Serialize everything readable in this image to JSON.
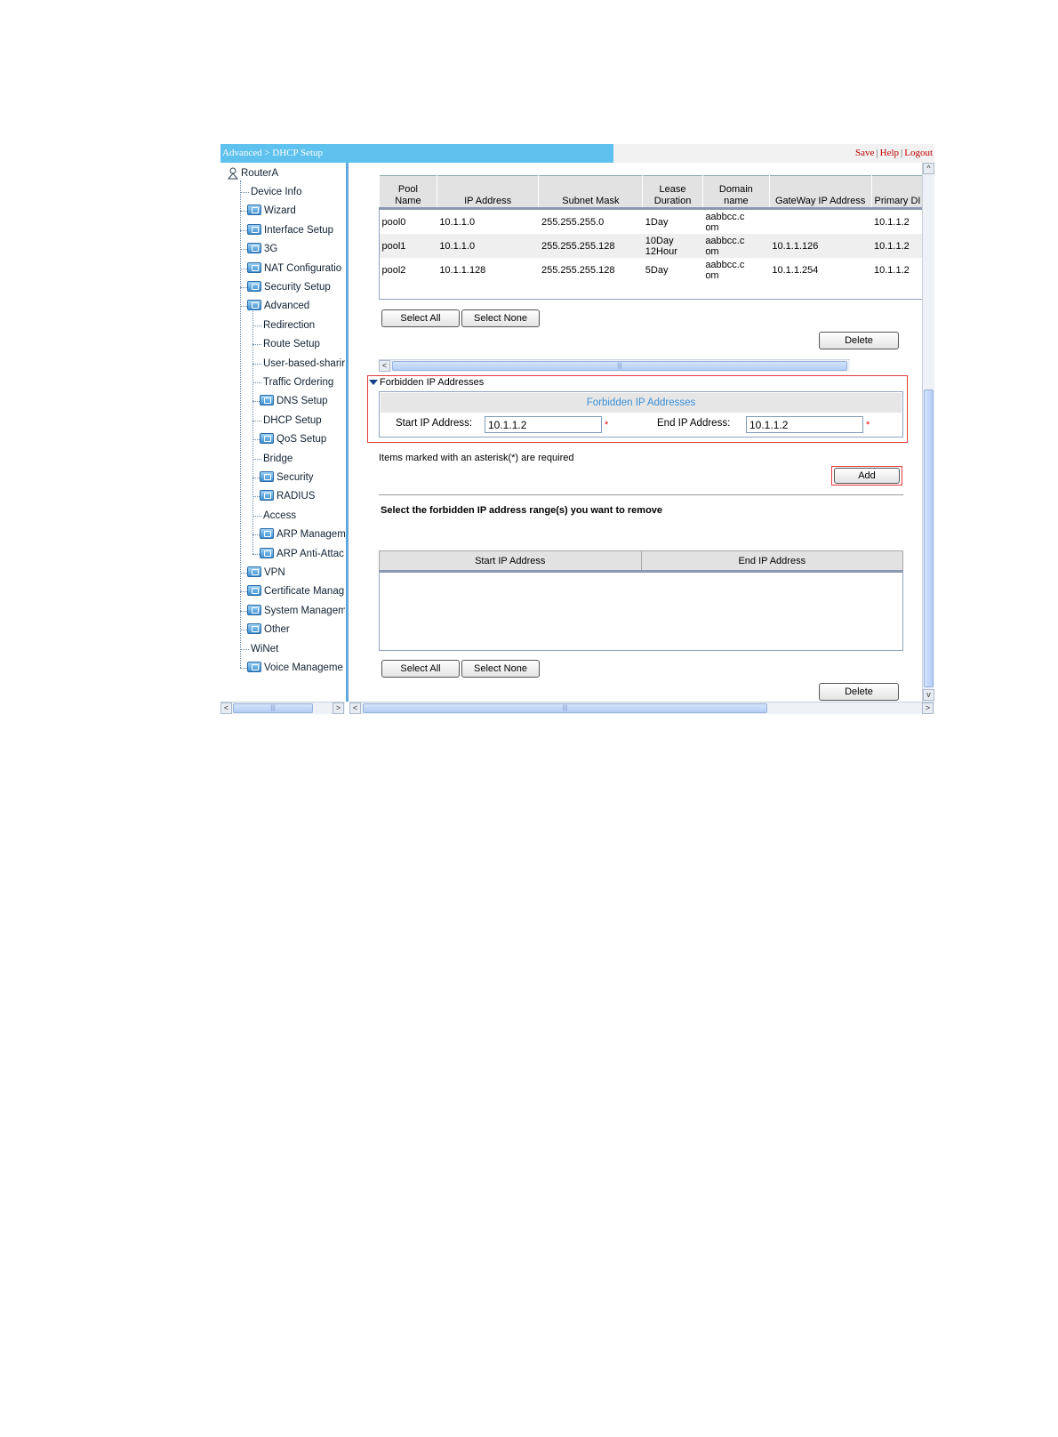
{
  "header": {
    "breadcrumb": "Advanced > DHCP Setup",
    "save": "Save",
    "help": "Help",
    "logout": "Logout",
    "separator": "|"
  },
  "sidebar": {
    "root": "RouterA",
    "items": [
      {
        "label": "Device Info",
        "icon": "none",
        "level": 1
      },
      {
        "label": "Wizard",
        "icon": "folder-icon",
        "level": 1
      },
      {
        "label": "Interface Setup",
        "icon": "folder-icon",
        "level": 1
      },
      {
        "label": "3G",
        "icon": "folder-icon",
        "level": 1
      },
      {
        "label": "NAT Configuratio",
        "icon": "folder-icon",
        "level": 1
      },
      {
        "label": "Security Setup",
        "icon": "folder-icon",
        "level": 1
      },
      {
        "label": "Advanced",
        "icon": "folder-icon",
        "level": 1
      },
      {
        "label": "Redirection",
        "icon": "none",
        "level": 2
      },
      {
        "label": "Route Setup",
        "icon": "none",
        "level": 2
      },
      {
        "label": "User-based-sharir",
        "icon": "none",
        "level": 2
      },
      {
        "label": "Traffic Ordering",
        "icon": "none",
        "level": 2
      },
      {
        "label": "DNS Setup",
        "icon": "folder-icon",
        "level": 2
      },
      {
        "label": "DHCP Setup",
        "icon": "none",
        "level": 2
      },
      {
        "label": "QoS Setup",
        "icon": "folder-icon",
        "level": 2
      },
      {
        "label": "Bridge",
        "icon": "none",
        "level": 2
      },
      {
        "label": "Security",
        "icon": "folder-icon",
        "level": 2
      },
      {
        "label": "RADIUS",
        "icon": "folder-icon",
        "level": 2
      },
      {
        "label": "Access",
        "icon": "none",
        "level": 2
      },
      {
        "label": "ARP Managem",
        "icon": "folder-icon",
        "level": 2
      },
      {
        "label": "ARP Anti-Attac",
        "icon": "folder-icon",
        "level": 2
      },
      {
        "label": "VPN",
        "icon": "folder-icon",
        "level": 1
      },
      {
        "label": "Certificate Manag",
        "icon": "folder-icon",
        "level": 1
      },
      {
        "label": "System Managem",
        "icon": "folder-icon",
        "level": 1
      },
      {
        "label": "Other",
        "icon": "folder-icon",
        "level": 1
      },
      {
        "label": "WiNet",
        "icon": "none",
        "level": 1
      },
      {
        "label": "Voice Manageme",
        "icon": "folder-icon",
        "level": 1
      }
    ]
  },
  "pool_table": {
    "columns": [
      {
        "l1": "Pool",
        "l2": "Name"
      },
      {
        "l1": "",
        "l2": "IP Address"
      },
      {
        "l1": "",
        "l2": "Subnet Mask"
      },
      {
        "l1": "Lease",
        "l2": "Duration"
      },
      {
        "l1": "Domain",
        "l2": "name"
      },
      {
        "l1": "",
        "l2": "GateWay IP Address"
      },
      {
        "l1": "",
        "l2": "Primary DI"
      }
    ],
    "rows": [
      {
        "name": "pool0",
        "ip": "10.1.1.0",
        "mask": "255.255.255.0",
        "lease1": "1Day",
        "lease2": "",
        "domain1": "aabbcc.c",
        "domain2": "om",
        "gateway": "",
        "dns": "10.1.1.2"
      },
      {
        "name": "pool1",
        "ip": "10.1.1.0",
        "mask": "255.255.255.128",
        "lease1": "10Day",
        "lease2": "12Hour",
        "domain1": "aabbcc.c",
        "domain2": "om",
        "gateway": "10.1.1.126",
        "dns": "10.1.1.2"
      },
      {
        "name": "pool2",
        "ip": "10.1.1.128",
        "mask": "255.255.255.128",
        "lease1": "5Day",
        "lease2": "",
        "domain1": "aabbcc.c",
        "domain2": "om",
        "gateway": "10.1.1.254",
        "dns": "10.1.1.2"
      }
    ],
    "select_all": "Select All",
    "select_none": "Select None",
    "delete": "Delete"
  },
  "forbidden": {
    "section_title": "Forbidden IP Addresses",
    "box_title": "Forbidden IP Addresses",
    "start_label": "Start IP Address:",
    "start_value": "10.1.1.2",
    "end_label": "End IP Address:",
    "end_value": "10.1.1.2",
    "asterisk": "*",
    "required_note": "Items marked with an asterisk(*) are required",
    "add": "Add"
  },
  "remove": {
    "title": "Select the forbidden IP address range(s) you want to remove",
    "col_start": "Start IP Address",
    "col_end": "End IP Address",
    "select_all": "Select All",
    "select_none": "Select None",
    "delete": "Delete"
  },
  "scroll": {
    "thumb_grip": "|||",
    "left": "<",
    "right": ">",
    "up": "^",
    "down": "v"
  }
}
